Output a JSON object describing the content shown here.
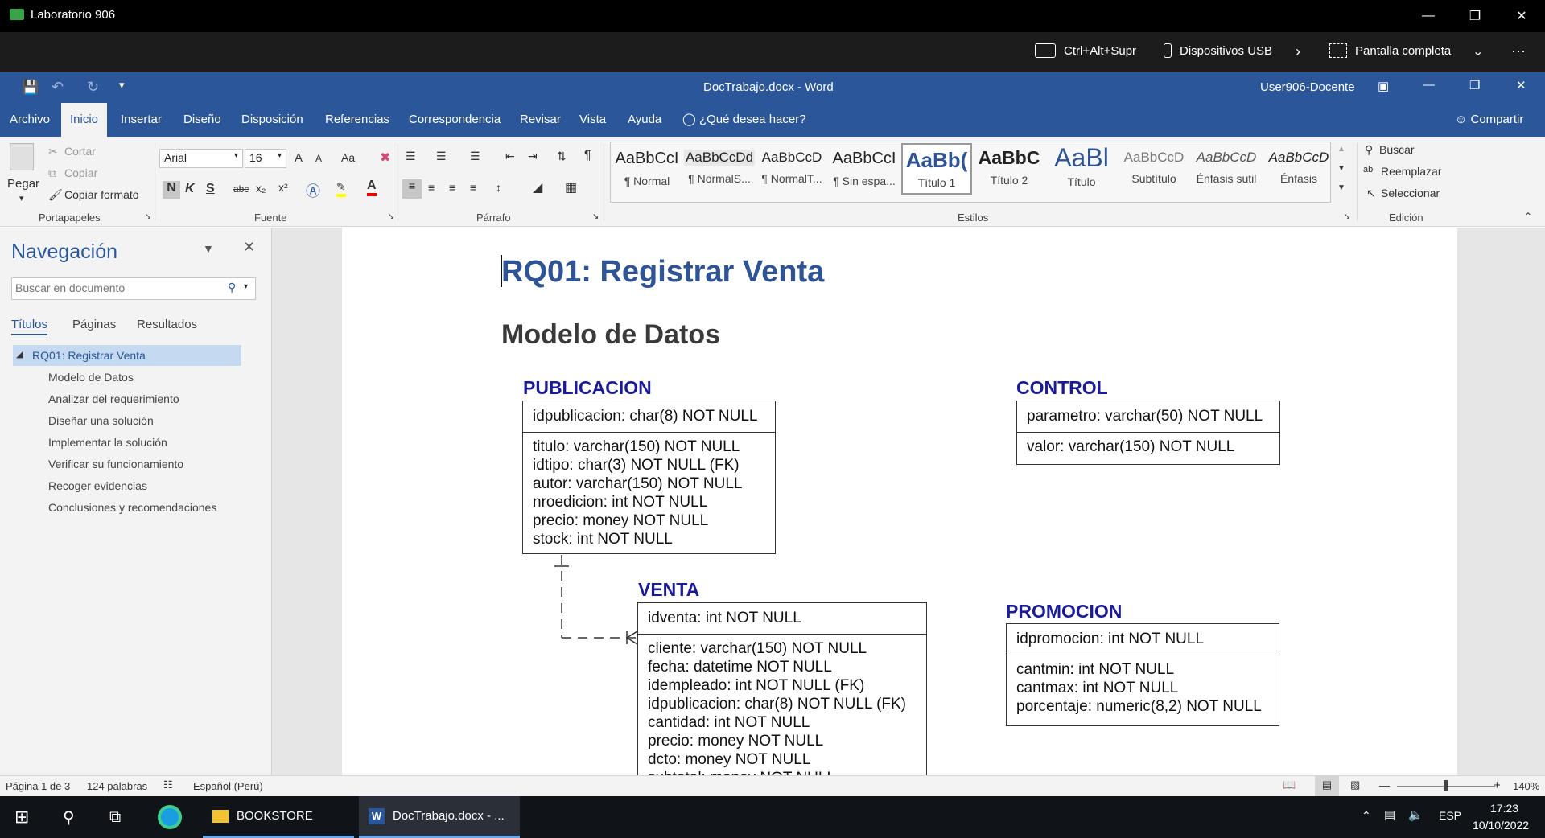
{
  "vm": {
    "title": "Laboratorio 906",
    "buttons": {
      "cad": "Ctrl+Alt+Supr",
      "usb": "Dispositivos USB",
      "fullscreen": "Pantalla completa"
    }
  },
  "word": {
    "doc_title": "DocTrabajo.docx  -  Word",
    "user": "User906-Docente",
    "tabs": [
      "Archivo",
      "Inicio",
      "Insertar",
      "Diseño",
      "Disposición",
      "Referencias",
      "Correspondencia",
      "Revisar",
      "Vista",
      "Ayuda"
    ],
    "tell_me": "¿Qué desea hacer?",
    "share": "Compartir"
  },
  "ribbon": {
    "clipboard": {
      "paste": "Pegar",
      "cut": "Cortar",
      "copy": "Copiar",
      "format_painter": "Copiar formato",
      "label": "Portapapeles"
    },
    "font": {
      "name": "Arial",
      "size": "16",
      "label": "Fuente",
      "bold": "N",
      "italic": "K",
      "underline": "S",
      "strike": "abc",
      "sub": "x₂",
      "sup": "x²",
      "grow": "A",
      "shrink": "A",
      "case": "Aa"
    },
    "paragraph": {
      "label": "Párrafo"
    },
    "styles": {
      "label": "Estilos",
      "items": [
        {
          "preview": "AaBbCcI",
          "name": "¶ Normal"
        },
        {
          "preview": "AaBbCcDd",
          "name": "¶ NormalS..."
        },
        {
          "preview": "AaBbCcD",
          "name": "¶ NormalT..."
        },
        {
          "preview": "AaBbCcI",
          "name": "¶ Sin espa..."
        },
        {
          "preview": "AaBb(",
          "name": "Título 1"
        },
        {
          "preview": "AaBbC",
          "name": "Título 2"
        },
        {
          "preview": "AaBl",
          "name": "Título"
        },
        {
          "preview": "AaBbCcD",
          "name": "Subtítulo"
        },
        {
          "preview": "AaBbCcD",
          "name": "Énfasis sutil"
        },
        {
          "preview": "AaBbCcD",
          "name": "Énfasis"
        }
      ]
    },
    "editing": {
      "label": "Edición",
      "find": "Buscar",
      "replace": "Reemplazar",
      "select": "Seleccionar"
    }
  },
  "navigation": {
    "title": "Navegación",
    "search_placeholder": "Buscar en documento",
    "tabs": [
      "Títulos",
      "Páginas",
      "Resultados"
    ],
    "top_heading": "RQ01: Registrar Venta",
    "items": [
      "Modelo de Datos",
      "Analizar del requerimiento",
      "Diseñar una solución",
      "Implementar la solución",
      "Verificar su funcionamiento",
      "Recoger evidencias",
      "Conclusiones y recomendaciones"
    ]
  },
  "document": {
    "h1": "RQ01: Registrar Venta",
    "h2": "Modelo de Datos",
    "entities": {
      "publicacion": {
        "name": "PUBLICACION",
        "pk": "idpublicacion: char(8) NOT NULL",
        "attrs": [
          "titulo: varchar(150) NOT NULL",
          "idtipo: char(3) NOT NULL (FK)",
          "autor: varchar(150) NOT NULL",
          "nroedicion: int NOT NULL",
          "precio: money NOT NULL",
          "stock: int NOT NULL"
        ]
      },
      "control": {
        "name": "CONTROL",
        "pk": "parametro: varchar(50) NOT NULL",
        "attrs": [
          "valor: varchar(150) NOT NULL"
        ]
      },
      "venta": {
        "name": "VENTA",
        "pk": "idventa: int NOT NULL",
        "attrs": [
          "cliente: varchar(150) NOT NULL",
          "fecha: datetime NOT NULL",
          "idempleado: int NOT NULL (FK)",
          "idpublicacion: char(8) NOT NULL (FK)",
          "cantidad: int NOT NULL",
          "precio: money NOT NULL",
          "dcto: money NOT NULL",
          "subtotal: money NOT NULL"
        ]
      },
      "promocion": {
        "name": "PROMOCION",
        "pk": "idpromocion: int NOT NULL",
        "attrs": [
          "cantmin: int NOT NULL",
          "cantmax: int NOT NULL",
          "porcentaje: numeric(8,2) NOT NULL"
        ]
      }
    }
  },
  "status": {
    "page": "Página 1 de 3",
    "words": "124 palabras",
    "language": "Español (Perú)",
    "zoom": "140%"
  },
  "taskbar": {
    "items": [
      "BOOKSTORE",
      "DocTrabajo.docx - ..."
    ],
    "lang": "ESP",
    "time": "17:23",
    "date": "10/10/2022"
  },
  "colors": {
    "word_blue": "#2b579a",
    "heading_blue": "#2f5496",
    "entity_blue": "#1a1a9a"
  }
}
